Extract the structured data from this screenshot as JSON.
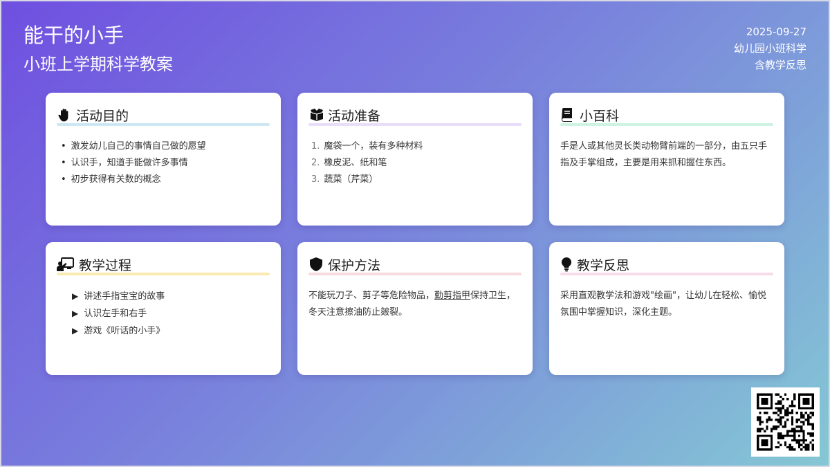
{
  "header": {
    "title": "能干的小手",
    "subtitle": "小班上学期科学教案",
    "date": "2025-09-27",
    "category": "幼儿园小班科学",
    "note": "含教学反思"
  },
  "cards": {
    "goal": {
      "title": "活动目的",
      "icon": "hand-icon",
      "accent": "#cfe7f3",
      "items": [
        "激发幼儿自己的事情自己做的愿望",
        "认识手，知道手能做许多事情",
        "初步获得有关数的概念"
      ]
    },
    "prep": {
      "title": "活动准备",
      "icon": "box-icon",
      "accent": "#e9defa",
      "items": [
        {
          "num": "1.",
          "text": "魔袋一个，装有多种材料"
        },
        {
          "num": "2.",
          "text": "橡皮泥、纸和笔"
        },
        {
          "num": "3.",
          "text": "蔬菜（芹菜）"
        }
      ]
    },
    "wiki": {
      "title": "小百科",
      "icon": "book-icon",
      "accent": "#cff3e2",
      "text": "手是人或其他灵长类动物臂前端的一部分，由五只手指及手掌组成，主要是用来抓和握住东西。"
    },
    "process": {
      "title": "教学过程",
      "icon": "teacher-icon",
      "accent": "#fbeab0",
      "items": [
        "讲述手指宝宝的故事",
        "认识左手和右手",
        "游戏《听话的小手》"
      ]
    },
    "protect": {
      "title": "保护方法",
      "icon": "shield-icon",
      "accent": "#f7dbe0",
      "text_before": "不能玩刀子、剪子等危险物品，",
      "text_link": "勤剪指甲",
      "text_after": "保持卫生，冬天注意擦油防止皴裂。"
    },
    "reflect": {
      "title": "教学反思",
      "icon": "lightbulb-icon",
      "accent": "#f7dbe9",
      "text": "采用直观教学法和游戏\"绘画\"，让幼儿在轻松、愉悦氛围中掌握知识，深化主题。"
    }
  },
  "qr": {
    "icon": "qr-code-icon"
  }
}
